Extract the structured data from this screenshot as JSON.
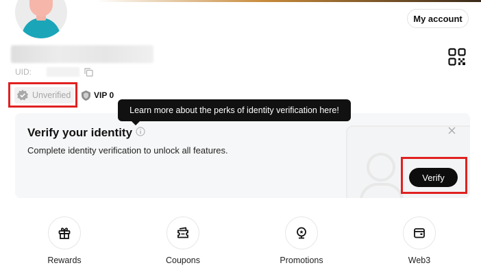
{
  "header": {
    "my_account_label": "My account"
  },
  "profile": {
    "uid_label": "UID:",
    "unverified_label": "Unverified",
    "vip_label": "VIP 0"
  },
  "tooltip": {
    "text": "Learn more about the perks of identity verification here!"
  },
  "verify_card": {
    "title": "Verify your identity",
    "description": "Complete identity verification to unlock all features.",
    "verify_button": "Verify"
  },
  "quick_links": [
    {
      "label": "Rewards",
      "icon": "gift-icon"
    },
    {
      "label": "Coupons",
      "icon": "coupon-icon"
    },
    {
      "label": "Promotions",
      "icon": "badge-icon"
    },
    {
      "label": "Web3",
      "icon": "wallet-icon"
    }
  ],
  "colors": {
    "highlight": "#e02020",
    "primary_button": "#0d0d0d",
    "card_bg": "#f6f7f8"
  }
}
